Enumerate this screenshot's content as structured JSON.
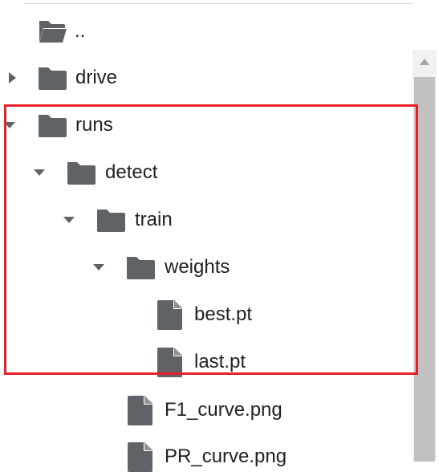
{
  "file_tree": {
    "items": [
      {
        "label": "..",
        "type": "folder-open",
        "expanded": null
      },
      {
        "label": "drive",
        "type": "folder",
        "expanded": false
      },
      {
        "label": "runs",
        "type": "folder",
        "expanded": true
      },
      {
        "label": "detect",
        "type": "folder",
        "expanded": true
      },
      {
        "label": "train",
        "type": "folder",
        "expanded": true
      },
      {
        "label": "weights",
        "type": "folder",
        "expanded": true
      },
      {
        "label": "best.pt",
        "type": "file"
      },
      {
        "label": "last.pt",
        "type": "file"
      },
      {
        "label": "F1_curve.png",
        "type": "file"
      },
      {
        "label": "PR_curve.png",
        "type": "file"
      }
    ]
  },
  "annotation": {
    "highlight_color": "#e8202a"
  },
  "colors": {
    "icon": "#5f6368",
    "text": "#202124",
    "scroll_track": "#f1f1f1",
    "scroll_thumb": "#c1c1c1"
  }
}
